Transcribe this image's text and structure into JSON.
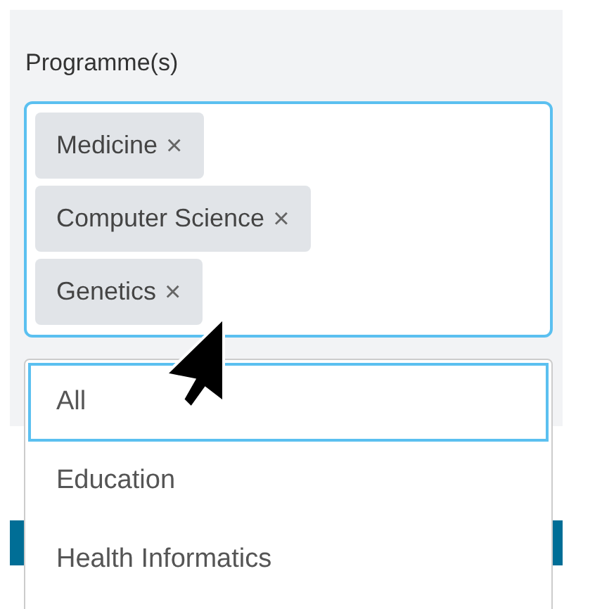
{
  "field": {
    "label": "Programme(s)",
    "tags": [
      {
        "label": "Medicine",
        "remove": "×"
      },
      {
        "label": "Computer Science",
        "remove": "×"
      },
      {
        "label": "Genetics",
        "remove": "×"
      }
    ]
  },
  "dropdown": {
    "options": [
      {
        "label": "All",
        "selected": true
      },
      {
        "label": "Education",
        "selected": false
      },
      {
        "label": "Health Informatics",
        "selected": false
      }
    ]
  }
}
